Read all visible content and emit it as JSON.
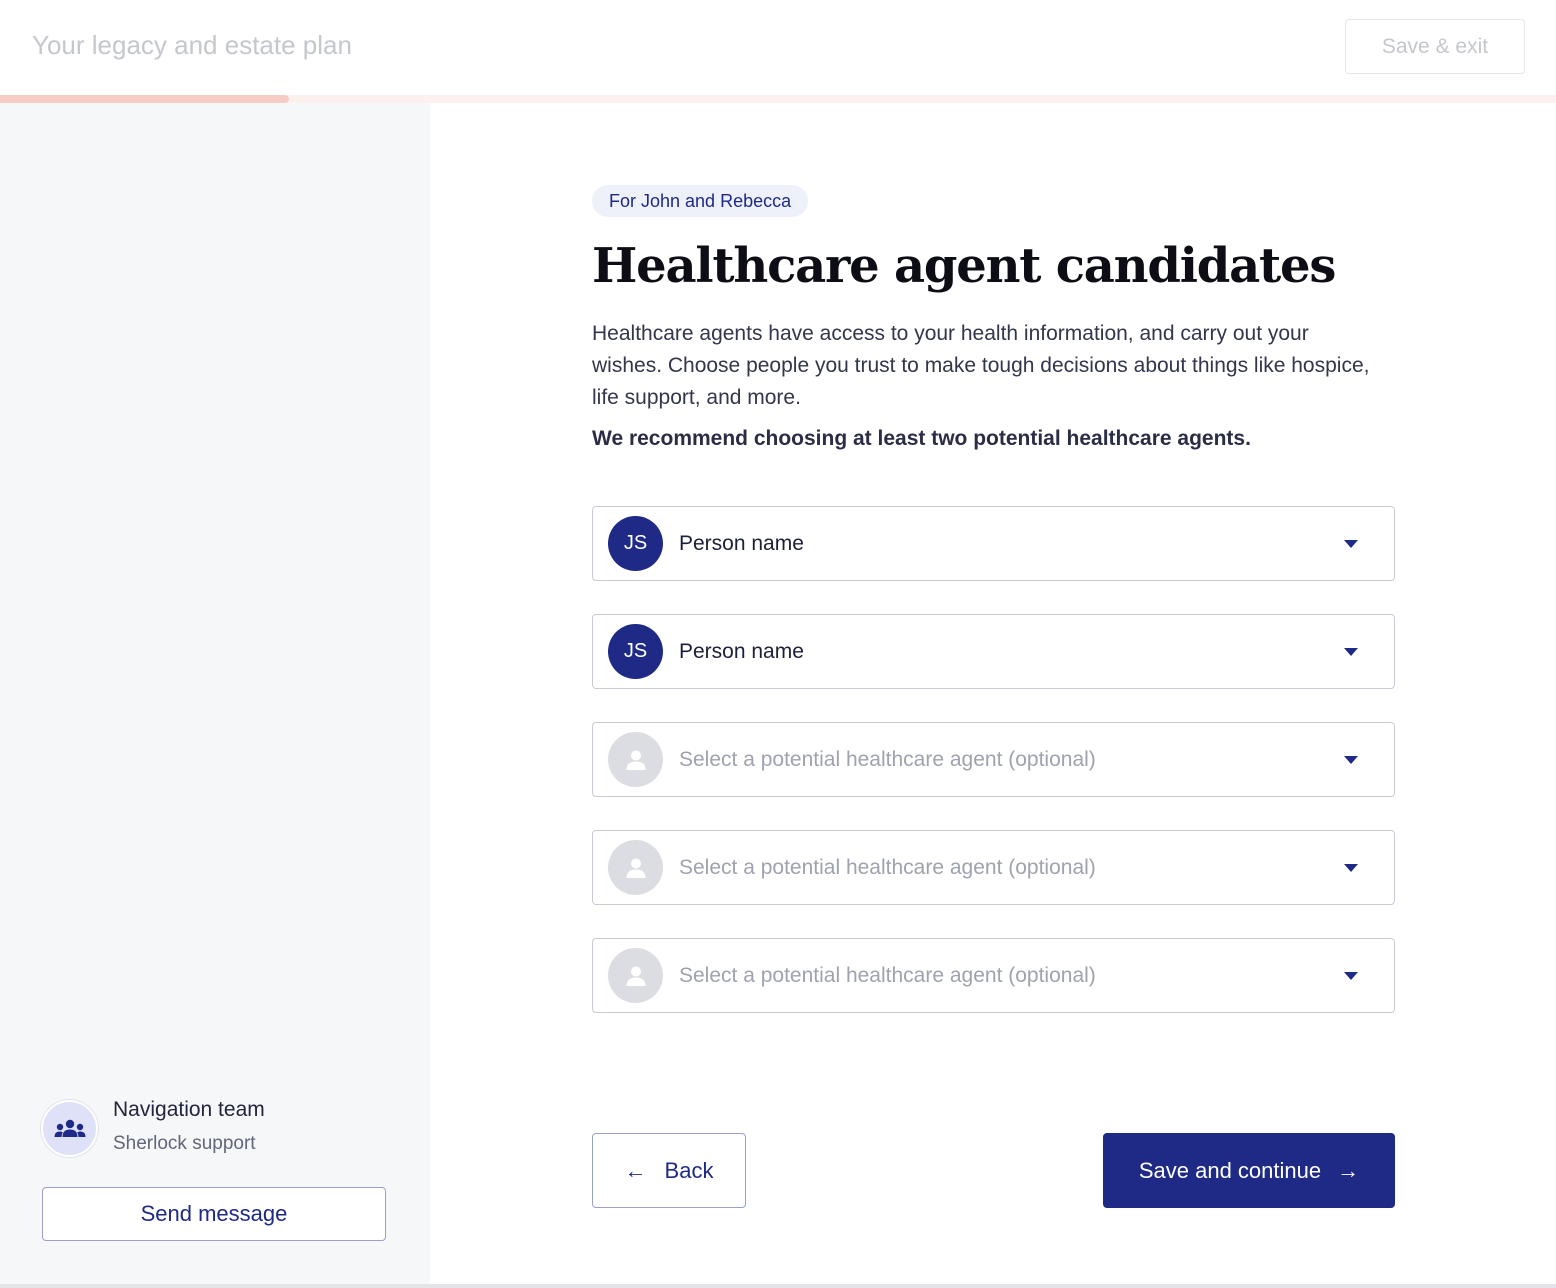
{
  "header": {
    "title": "Your legacy and estate plan",
    "save_exit_label": "Save & exit",
    "progress": 0.186
  },
  "main": {
    "for_chip": "For John and Rebecca",
    "heading": "Healthcare agent candidates",
    "description": "Healthcare agents have access to your health information, and carry out your wishes. Choose people you trust to make tough decisions about things like hospice, life support, and more.",
    "recommendation": "We recommend choosing at least two potential healthcare agents.",
    "agents": [
      {
        "initials": "JS",
        "label": "Person name",
        "selected": true
      },
      {
        "initials": "JS",
        "label": "Person name",
        "selected": true
      },
      {
        "initials": "",
        "label": "Select a potential healthcare agent (optional)",
        "selected": false
      },
      {
        "initials": "",
        "label": "Select a potential healthcare agent (optional)",
        "selected": false
      },
      {
        "initials": "",
        "label": "Select a potential healthcare agent (optional)",
        "selected": false
      }
    ],
    "back_label": "Back",
    "continue_label": "Save and continue"
  },
  "sidebar": {
    "support_name": "Navigation team",
    "support_sub": "Sherlock support",
    "send_message_label": "Send message",
    "support_icon": "group-icon"
  },
  "colors": {
    "brand": "#1e2a86",
    "progress": "#f7ccc6",
    "sidebar_bg": "#f6f7f9"
  }
}
